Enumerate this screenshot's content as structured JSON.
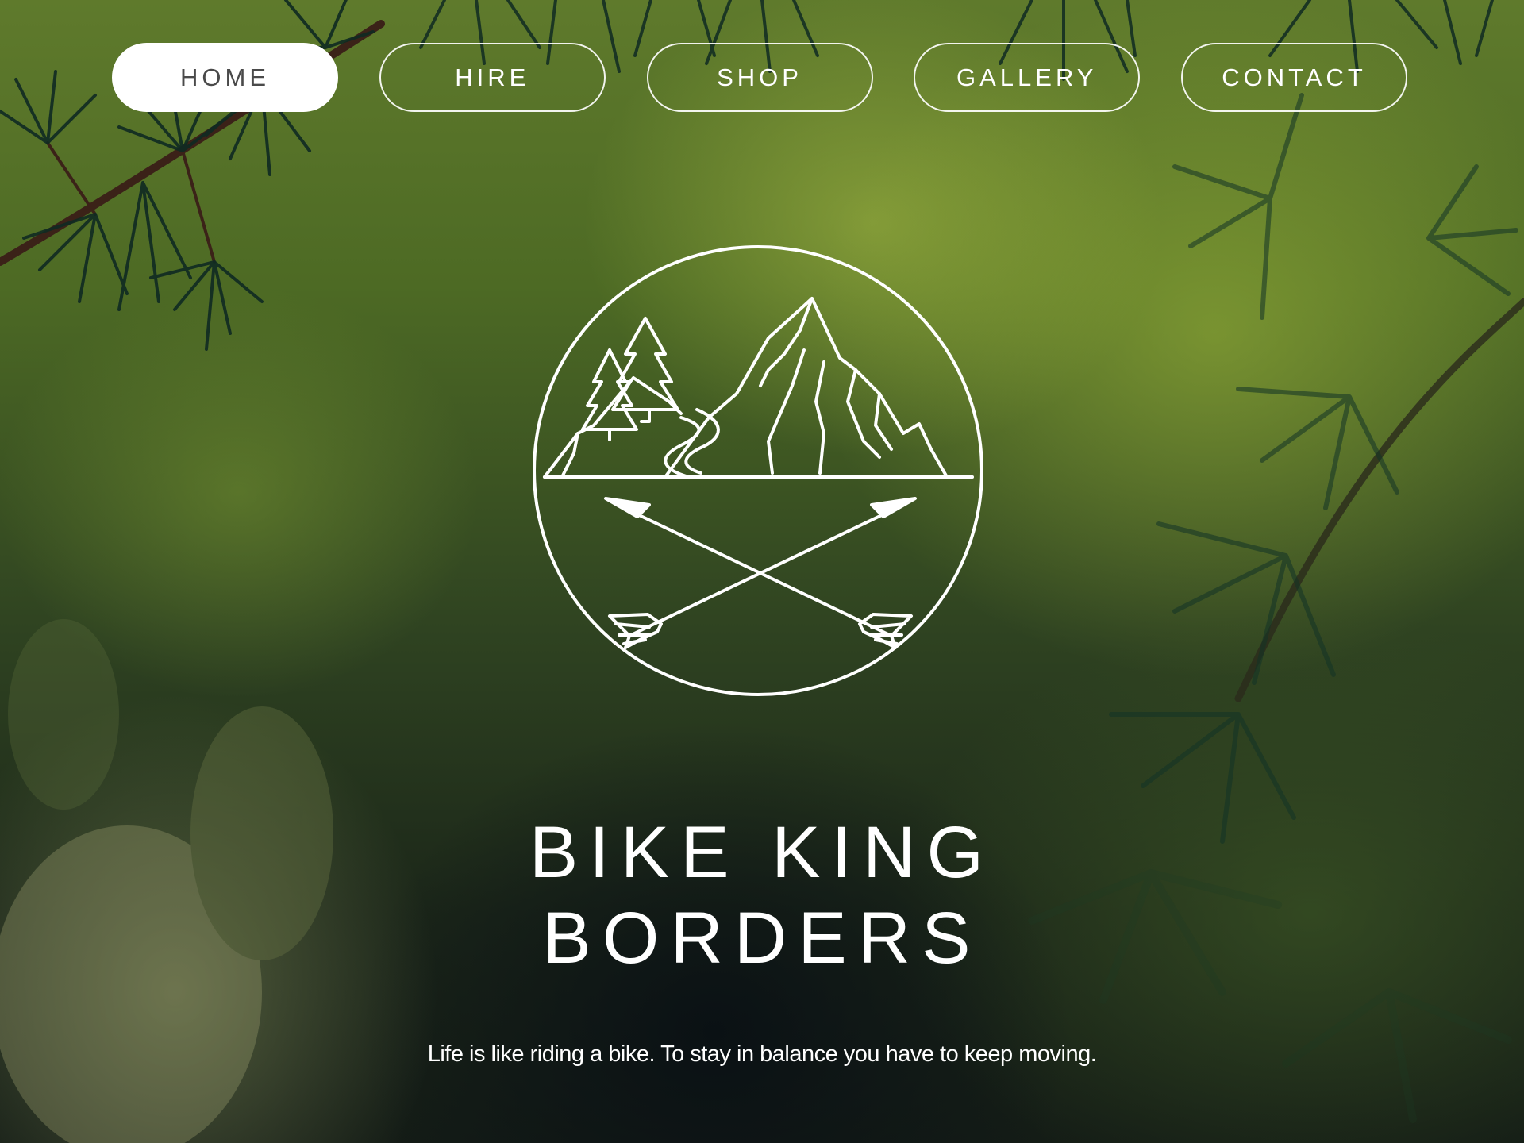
{
  "nav": {
    "items": [
      {
        "label": "HOME",
        "active": true
      },
      {
        "label": "HIRE",
        "active": false
      },
      {
        "label": "SHOP",
        "active": false
      },
      {
        "label": "GALLERY",
        "active": false
      },
      {
        "label": "CONTACT",
        "active": false
      }
    ]
  },
  "hero": {
    "title_line1": "BIKE KING",
    "title_line2": "BORDERS",
    "tagline": "Life is like riding a bike. To stay in balance you have to keep moving."
  },
  "logo": {
    "icon": "mountain-arrows-emblem"
  },
  "colors": {
    "accent": "#ffffff",
    "active_nav_text": "#4a4a4a",
    "background_green": "#5f7a2c"
  }
}
